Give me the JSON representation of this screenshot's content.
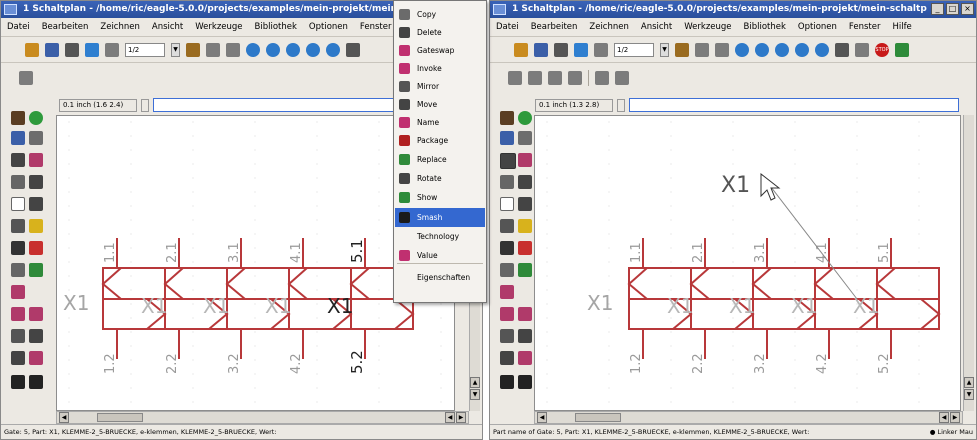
{
  "left_window": {
    "title": "1 Schaltplan - /home/ric/eagle-5.0.0/projects/examples/mein-projekt/mein-",
    "menu": [
      "Datei",
      "Bearbeiten",
      "Zeichnen",
      "Ansicht",
      "Werkzeuge",
      "Bibliothek",
      "Optionen",
      "Fenster"
    ],
    "toolbar": {
      "sheet_combo": "1/2"
    },
    "coord_display": "0.1 inch (1.6 2.4)",
    "canvas": {
      "part_label": "X1",
      "pin_labels_top": [
        "1.1",
        "2.1",
        "3.1",
        "4.1",
        "5.1"
      ],
      "pin_labels_bottom": [
        "1.2",
        "2.2",
        "3.2",
        "4.2",
        "5.2"
      ],
      "gate_labels": [
        "X1",
        "X1",
        "X1",
        "X1"
      ]
    },
    "status": "Gate: 5, Part: X1, KLEMME-2_5-BRUECKE, e-klemmen, KLEMME-2_5-BRUECKE, Wert:"
  },
  "context_menu": {
    "items": [
      {
        "label": "Copy",
        "icon": "copy-icon",
        "color": "#6b6b6b"
      },
      {
        "label": "Delete",
        "icon": "delete-icon",
        "color": "#444444"
      },
      {
        "label": "Gateswap",
        "icon": "gateswap-icon",
        "color": "#c03070"
      },
      {
        "label": "Invoke",
        "icon": "invoke-icon",
        "color": "#c03070"
      },
      {
        "label": "Mirror",
        "icon": "mirror-icon",
        "color": "#555555"
      },
      {
        "label": "Move",
        "icon": "move-icon",
        "color": "#444444"
      },
      {
        "label": "Name",
        "icon": "name-icon",
        "color": "#c03070"
      },
      {
        "label": "Package",
        "icon": "package-icon",
        "color": "#b02020"
      },
      {
        "label": "Replace",
        "icon": "replace-icon",
        "color": "#2f8a3a"
      },
      {
        "label": "Rotate",
        "icon": "rotate-icon",
        "color": "#444444"
      },
      {
        "label": "Show",
        "icon": "show-icon",
        "color": "#2e8b3a"
      },
      {
        "label": "Smash",
        "icon": "smash-icon",
        "color": "#1a1a1a",
        "selected": true
      },
      {
        "label": "Technology",
        "icon": "",
        "color": ""
      },
      {
        "label": "Value",
        "icon": "value-icon",
        "color": "#c03070"
      },
      {
        "label": "Eigenschaften",
        "icon": "",
        "color": ""
      }
    ]
  },
  "right_window": {
    "title": "1 Schaltplan - /home/ric/eagle-5.0.0/projects/examples/mein-projekt/mein-schaltp",
    "menu": [
      "Datei",
      "Bearbeiten",
      "Zeichnen",
      "Ansicht",
      "Werkzeuge",
      "Bibliothek",
      "Optionen",
      "Fenster",
      "Hilfe"
    ],
    "toolbar": {
      "sheet_combo": "1/2",
      "stop_label": "STOP"
    },
    "coord_display": "0.1 inch (1.3 2.8)",
    "canvas": {
      "part_label": "X1",
      "smashed_label": "X1",
      "pin_labels_top": [
        "1.1",
        "2.1",
        "3.1",
        "4.1",
        "5.1"
      ],
      "pin_labels_bottom": [
        "1.2",
        "2.2",
        "3.2",
        "4.2",
        "5.2"
      ],
      "gate_labels": [
        "X1",
        "X1",
        "X1",
        "X1"
      ]
    },
    "status": "Part name of Gate: 5, Part: X1, KLEMME-2_5-BRUECKE, e-klemmen, KLEMME-2_5-BRUECKE, Wert:",
    "status_right": "● Linker Mau"
  },
  "colors": {
    "part": "#b8383a",
    "titlebar": "#2e56a8",
    "selection": "#3468d0"
  }
}
